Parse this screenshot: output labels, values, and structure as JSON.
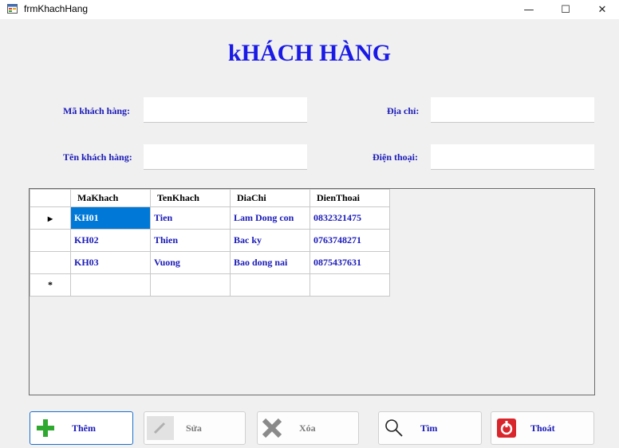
{
  "window": {
    "title": "frmKhachHang",
    "min_glyph": "—",
    "max_glyph": "☐",
    "close_glyph": "✕"
  },
  "form": {
    "title": "kHÁCH HÀNG",
    "labels": {
      "ma": "Mã khách hàng:",
      "ten": "Tên khách hàng:",
      "diachi": "Địa chỉ:",
      "dienthoai": "Điện thoại:"
    },
    "inputs": {
      "ma": "",
      "ten": "",
      "diachi": "",
      "dienthoai": ""
    }
  },
  "grid": {
    "columns": [
      "MaKhach",
      "TenKhach",
      "DiaChi",
      "DienThoai"
    ],
    "rows": [
      [
        "KH01",
        "Tien",
        "Lam Dong con",
        "0832321475"
      ],
      [
        "KH02",
        "Thien",
        "Bac ky",
        "0763748271"
      ],
      [
        "KH03",
        "Vuong",
        "Bao dong nai",
        "0875437631"
      ]
    ],
    "current_row_glyph": "▶",
    "new_row_glyph": "*"
  },
  "buttons": {
    "them": {
      "label": "Thêm",
      "icon": "plus-icon"
    },
    "sua": {
      "label": "Sửa",
      "icon": "pencil-icon"
    },
    "xoa": {
      "label": "Xóa",
      "icon": "x-icon"
    },
    "tim": {
      "label": "Tìm",
      "icon": "search-icon"
    },
    "thoat": {
      "label": "Thoát",
      "icon": "exit-icon"
    }
  },
  "colors": {
    "label_blue": "#1a1ab8",
    "title_blue": "#1a1ae6",
    "selection": "#0078d7",
    "plus_green": "#2fa82f",
    "exit_red": "#d9262c"
  }
}
